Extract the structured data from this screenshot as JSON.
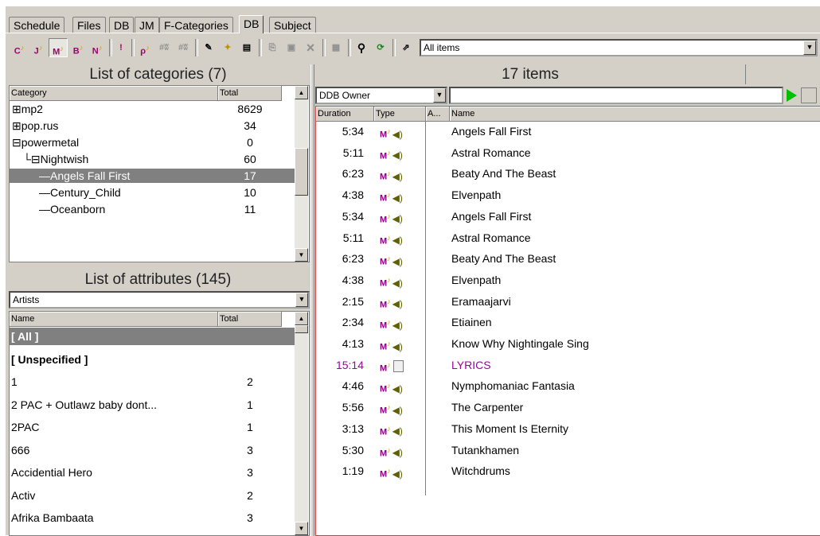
{
  "tabs": [
    "Schedule",
    "Files",
    "DB",
    "JM",
    "F-Categories",
    "DB",
    "Subject"
  ],
  "active_tab_index": 5,
  "toolbar": {
    "filter_value": "All items",
    "buttons": [
      "C",
      "J",
      "M",
      "B",
      "N",
      "!",
      "P",
      "#",
      "#",
      "edit",
      "new",
      "props",
      "copy",
      "paste",
      "delete",
      "settings",
      "find",
      "refresh",
      "pin"
    ]
  },
  "categories": {
    "title": "List of categories (7)",
    "col_category": "Category",
    "col_total": "Total",
    "rows": [
      {
        "name": "mp2",
        "total": "8629",
        "prefix": "⊞",
        "selected": false
      },
      {
        "name": "pop.rus",
        "total": "34",
        "prefix": "⊞",
        "selected": false
      },
      {
        "name": "powermetal",
        "total": "0",
        "prefix": "⊟",
        "selected": false
      },
      {
        "name": "Nightwish",
        "total": "60",
        "prefix": "└⊟",
        "selected": false
      },
      {
        "name": "Angels Fall First",
        "total": "17",
        "prefix": "—",
        "selected": true
      },
      {
        "name": "Century_Child",
        "total": "10",
        "prefix": "—",
        "selected": false
      },
      {
        "name": "Oceanborn",
        "total": "11",
        "prefix": "—",
        "selected": false
      }
    ]
  },
  "attributes": {
    "title": "List of attributes (145)",
    "dropdown_value": "Artists",
    "col_name": "Name",
    "col_total": "Total",
    "rows": [
      {
        "name": "[ All ]",
        "total": "",
        "bold": true,
        "selected": true
      },
      {
        "name": "[ Unspecified ]",
        "total": "",
        "bold": true,
        "selected": false
      },
      {
        "name": "1",
        "total": "2",
        "bold": false,
        "selected": false
      },
      {
        "name": "2 PAC + Outlawz baby dont...",
        "total": "1",
        "bold": false,
        "selected": false
      },
      {
        "name": "2PAC",
        "total": "1",
        "bold": false,
        "selected": false
      },
      {
        "name": "666",
        "total": "3",
        "bold": false,
        "selected": false
      },
      {
        "name": "Accidential Hero",
        "total": "3",
        "bold": false,
        "selected": false
      },
      {
        "name": "Activ",
        "total": "2",
        "bold": false,
        "selected": false
      },
      {
        "name": "Afrika Bambaata",
        "total": "3",
        "bold": false,
        "selected": false
      }
    ]
  },
  "items": {
    "title": "17 items",
    "filter_field": "DDB Owner",
    "filter_text": "",
    "col_duration": "Duration",
    "col_type": "Type",
    "col_a": "A...",
    "col_name": "Name",
    "rows": [
      {
        "duration": "5:34",
        "name": "Angels Fall First",
        "kind": "audio"
      },
      {
        "duration": "5:11",
        "name": "Astral Romance",
        "kind": "audio"
      },
      {
        "duration": "6:23",
        "name": "Beaty And The Beast",
        "kind": "audio"
      },
      {
        "duration": "4:38",
        "name": "Elvenpath",
        "kind": "audio"
      },
      {
        "duration": "5:34",
        "name": "Angels Fall First",
        "kind": "audio"
      },
      {
        "duration": "5:11",
        "name": "Astral Romance",
        "kind": "audio"
      },
      {
        "duration": "6:23",
        "name": "Beaty And The Beast",
        "kind": "audio"
      },
      {
        "duration": "4:38",
        "name": "Elvenpath",
        "kind": "audio"
      },
      {
        "duration": "2:15",
        "name": "Eramaajarvi",
        "kind": "audio"
      },
      {
        "duration": "2:34",
        "name": "Etiainen",
        "kind": "audio"
      },
      {
        "duration": "4:13",
        "name": "Know Why Nightingale Sing",
        "kind": "audio"
      },
      {
        "duration": "15:14",
        "name": "LYRICS",
        "kind": "doc"
      },
      {
        "duration": "4:46",
        "name": "Nymphomaniac Fantasia",
        "kind": "audio"
      },
      {
        "duration": "5:56",
        "name": "The Carpenter",
        "kind": "audio"
      },
      {
        "duration": "3:13",
        "name": "This Moment Is Eternity",
        "kind": "audio"
      },
      {
        "duration": "5:30",
        "name": "Tutankhamen",
        "kind": "audio"
      },
      {
        "duration": "1:19",
        "name": "Witchdrums",
        "kind": "audio"
      }
    ]
  },
  "colors": {
    "lyrics": "#a000a0",
    "selection": "#808080",
    "play": "#00c000",
    "border_red": "#d04040"
  }
}
